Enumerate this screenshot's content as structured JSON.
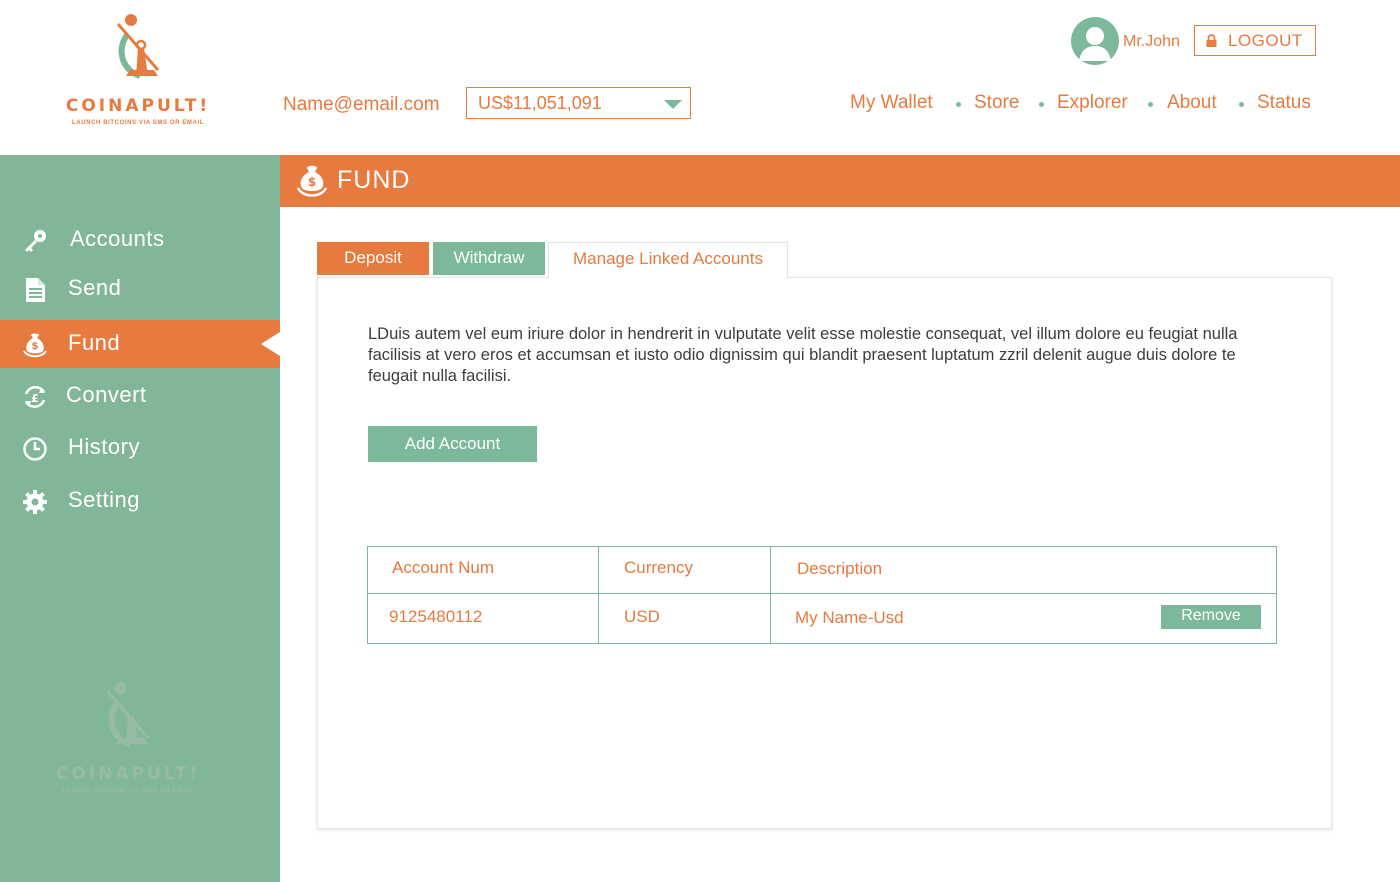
{
  "brand": {
    "name": "COINAPULT!",
    "tagline": "LAUNCH BITCOINS VIA SMS OR EMAIL"
  },
  "header": {
    "email": "Name@email.com",
    "balance": "US$11,051,091",
    "username": "Mr.John",
    "logout_label": "LOGOUT",
    "nav": [
      "My Wallet",
      "Store",
      "Explorer",
      "About",
      "Status"
    ]
  },
  "sidebar": {
    "items": [
      {
        "label": "Accounts",
        "icon": "key-icon"
      },
      {
        "label": "Send",
        "icon": "document-icon"
      },
      {
        "label": "Fund",
        "icon": "money-bag-icon",
        "active": true
      },
      {
        "label": "Convert",
        "icon": "currency-exchange-icon"
      },
      {
        "label": "History",
        "icon": "clock-icon"
      },
      {
        "label": "Setting",
        "icon": "gear-icon"
      }
    ]
  },
  "page": {
    "title": "FUND",
    "tabs": [
      "Deposit",
      "Withdraw",
      "Manage Linked Accounts"
    ],
    "active_tab": "Manage Linked Accounts",
    "description": "LDuis autem vel eum iriure dolor in hendrerit in vulputate velit esse molestie consequat, vel illum dolore eu feugiat nulla facilisis at vero eros et accumsan et iusto odio dignissim qui blandit praesent luptatum zzril delenit augue duis dolore te feugait nulla facilisi.",
    "add_button": "Add Account"
  },
  "table": {
    "headers": [
      "Account Num",
      "Currency",
      "Description"
    ],
    "rows": [
      {
        "account_num": "9125480112",
        "currency": "USD",
        "description": "My Name-Usd",
        "action": "Remove"
      }
    ]
  },
  "colors": {
    "orange": "#e67a3f",
    "green": "#81b798",
    "text": "#3d3d3d"
  }
}
